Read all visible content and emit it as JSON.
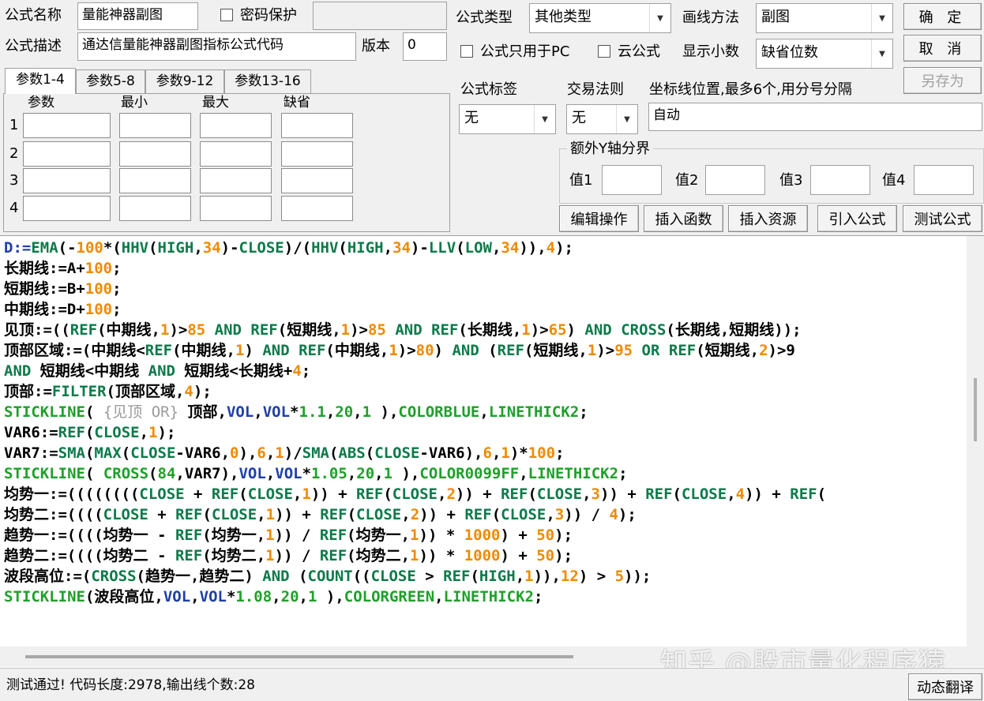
{
  "header": {
    "name_label": "公式名称",
    "name_value": "量能神器副图",
    "password_label": "密码保护",
    "desc_label": "公式描述",
    "desc_value": "通达信量能神器副图指标公式代码",
    "version_label": "版本",
    "version_value": "0",
    "type_label": "公式类型",
    "type_value": "其他类型",
    "draw_label": "画线方法",
    "draw_value": "副图",
    "pc_only_label": "公式只用于PC",
    "cloud_label": "云公式",
    "decimals_label": "显示小数",
    "decimals_value": "缺省位数",
    "ok_button": "确  定",
    "cancel_button": "取  消",
    "save_as_button": "另存为"
  },
  "params": {
    "tabs": [
      "参数1-4",
      "参数5-8",
      "参数9-12",
      "参数13-16"
    ],
    "columns": [
      "参数",
      "最小",
      "最大",
      "缺省"
    ],
    "rows": [
      "1",
      "2",
      "3",
      "4"
    ]
  },
  "options": {
    "tag_label": "公式标签",
    "tag_value": "无",
    "rule_label": "交易法则",
    "rule_value": "无",
    "coord_label": "坐标线位置,最多6个,用分号分隔",
    "coord_value": "自动",
    "yaxis_group": "额外Y轴分界",
    "y_labels": [
      "值1",
      "值2",
      "值3",
      "值4"
    ]
  },
  "actions": [
    "编辑操作",
    "插入函数",
    "插入资源",
    "引入公式",
    "测试公式"
  ],
  "editor": {
    "lines": [
      [
        [
          "D:=",
          "v"
        ],
        [
          "EMA",
          "f"
        ],
        [
          "(-",
          "d"
        ],
        [
          "100",
          "n"
        ],
        [
          "*(",
          "d"
        ],
        [
          "HHV",
          "f"
        ],
        [
          "(",
          "d"
        ],
        [
          "HIGH",
          "f"
        ],
        [
          ",",
          "d"
        ],
        [
          "34",
          "n"
        ],
        [
          ")-",
          "d"
        ],
        [
          "CLOSE",
          "f"
        ],
        [
          ")/(",
          "d"
        ],
        [
          "HHV",
          "f"
        ],
        [
          "(",
          "d"
        ],
        [
          "HIGH",
          "f"
        ],
        [
          ",",
          "d"
        ],
        [
          "34",
          "n"
        ],
        [
          ")-",
          "d"
        ],
        [
          "LLV",
          "f"
        ],
        [
          "(",
          "d"
        ],
        [
          "LOW",
          "f"
        ],
        [
          ",",
          "d"
        ],
        [
          "34",
          "n"
        ],
        [
          ")),",
          "d"
        ],
        [
          "4",
          "n"
        ],
        [
          ");",
          "d"
        ]
      ],
      [
        [
          "长期线:=A+",
          "d"
        ],
        [
          "100",
          "n"
        ],
        [
          ";",
          "d"
        ]
      ],
      [
        [
          "短期线:=B+",
          "d"
        ],
        [
          "100",
          "n"
        ],
        [
          ";",
          "d"
        ]
      ],
      [
        [
          "中期线:=D+",
          "d"
        ],
        [
          "100",
          "n"
        ],
        [
          ";",
          "d"
        ]
      ],
      [
        [
          "见顶:=((",
          "d"
        ],
        [
          "REF",
          "f"
        ],
        [
          "(中期线,",
          "d"
        ],
        [
          "1",
          "n"
        ],
        [
          ")>",
          "d"
        ],
        [
          "85",
          "n"
        ],
        [
          " AND ",
          "f"
        ],
        [
          "REF",
          "f"
        ],
        [
          "(短期线,",
          "d"
        ],
        [
          "1",
          "n"
        ],
        [
          ")>",
          "d"
        ],
        [
          "85",
          "n"
        ],
        [
          " AND ",
          "f"
        ],
        [
          "REF",
          "f"
        ],
        [
          "(长期线,",
          "d"
        ],
        [
          "1",
          "n"
        ],
        [
          ")>",
          "d"
        ],
        [
          "65",
          "n"
        ],
        [
          ") ",
          "d"
        ],
        [
          "AND ",
          "f"
        ],
        [
          "CROSS",
          "f"
        ],
        [
          "(长期线,短期线));",
          "d"
        ]
      ],
      [
        [
          "顶部区域:=(中期线<",
          "d"
        ],
        [
          "REF",
          "f"
        ],
        [
          "(中期线,",
          "d"
        ],
        [
          "1",
          "n"
        ],
        [
          ") ",
          "d"
        ],
        [
          "AND ",
          "f"
        ],
        [
          "REF",
          "f"
        ],
        [
          "(中期线,",
          "d"
        ],
        [
          "1",
          "n"
        ],
        [
          ")>",
          "d"
        ],
        [
          "80",
          "n"
        ],
        [
          ") ",
          "d"
        ],
        [
          "AND ",
          "f"
        ],
        [
          "(",
          "d"
        ],
        [
          "REF",
          "f"
        ],
        [
          "(短期线,",
          "d"
        ],
        [
          "1",
          "n"
        ],
        [
          ")>",
          "d"
        ],
        [
          "95",
          "n"
        ],
        [
          " OR ",
          "f"
        ],
        [
          "REF",
          "f"
        ],
        [
          "(短期线,",
          "d"
        ],
        [
          "2",
          "n"
        ],
        [
          ")>9",
          "d"
        ]
      ],
      [
        [
          "AND ",
          "f"
        ],
        [
          "短期线<中期线 ",
          "d"
        ],
        [
          "AND ",
          "f"
        ],
        [
          "短期线<长期线+",
          "d"
        ],
        [
          "4",
          "n"
        ],
        [
          ";",
          "d"
        ]
      ],
      [
        [
          "顶部:=",
          "d"
        ],
        [
          "FILTER",
          "f"
        ],
        [
          "(顶部区域,",
          "d"
        ],
        [
          "4",
          "n"
        ],
        [
          ");",
          "d"
        ]
      ],
      [
        [
          "STICKLINE",
          "g"
        ],
        [
          "( ",
          "d"
        ],
        [
          "{见顶 OR}",
          "c"
        ],
        [
          " 顶部,",
          "d"
        ],
        [
          "VOL",
          "v"
        ],
        [
          ",",
          "d"
        ],
        [
          "VOL",
          "v"
        ],
        [
          "*",
          "d"
        ],
        [
          "1.1",
          "g"
        ],
        [
          ",",
          "d"
        ],
        [
          "20",
          "g"
        ],
        [
          ",",
          "d"
        ],
        [
          "1",
          "g"
        ],
        [
          " ),",
          "d"
        ],
        [
          "COLORBLUE",
          "g"
        ],
        [
          ",",
          "d"
        ],
        [
          "LINETHICK2",
          "g"
        ],
        [
          ";",
          "d"
        ]
      ],
      [
        [
          "VAR6:=",
          "d"
        ],
        [
          "REF",
          "f"
        ],
        [
          "(",
          "d"
        ],
        [
          "CLOSE",
          "f"
        ],
        [
          ",",
          "d"
        ],
        [
          "1",
          "n"
        ],
        [
          ");",
          "d"
        ]
      ],
      [
        [
          "VAR7:=",
          "d"
        ],
        [
          "SMA",
          "f"
        ],
        [
          "(",
          "d"
        ],
        [
          "MAX",
          "f"
        ],
        [
          "(",
          "d"
        ],
        [
          "CLOSE",
          "f"
        ],
        [
          "-VAR6,",
          "d"
        ],
        [
          "0",
          "n"
        ],
        [
          "),",
          "d"
        ],
        [
          "6",
          "n"
        ],
        [
          ",",
          "d"
        ],
        [
          "1",
          "n"
        ],
        [
          ")/",
          "d"
        ],
        [
          "SMA",
          "f"
        ],
        [
          "(",
          "d"
        ],
        [
          "ABS",
          "f"
        ],
        [
          "(",
          "d"
        ],
        [
          "CLOSE",
          "f"
        ],
        [
          "-VAR6),",
          "d"
        ],
        [
          "6",
          "n"
        ],
        [
          ",",
          "d"
        ],
        [
          "1",
          "n"
        ],
        [
          ")*",
          "d"
        ],
        [
          "100",
          "n"
        ],
        [
          ";",
          "d"
        ]
      ],
      [
        [
          "STICKLINE",
          "g"
        ],
        [
          "( ",
          "d"
        ],
        [
          "CROSS",
          "g"
        ],
        [
          "(",
          "d"
        ],
        [
          "84",
          "g"
        ],
        [
          ",VAR7),",
          "d"
        ],
        [
          "VOL",
          "v"
        ],
        [
          ",",
          "d"
        ],
        [
          "VOL",
          "v"
        ],
        [
          "*",
          "d"
        ],
        [
          "1.05",
          "g"
        ],
        [
          ",",
          "d"
        ],
        [
          "20",
          "g"
        ],
        [
          ",",
          "d"
        ],
        [
          "1",
          "g"
        ],
        [
          " ),",
          "d"
        ],
        [
          "COLOR0099FF",
          "g"
        ],
        [
          ",",
          "d"
        ],
        [
          "LINETHICK2",
          "g"
        ],
        [
          ";",
          "d"
        ]
      ],
      [
        [
          "均势一:=((((((((",
          "d"
        ],
        [
          "CLOSE",
          "f"
        ],
        [
          " + ",
          "d"
        ],
        [
          "REF",
          "f"
        ],
        [
          "(",
          "d"
        ],
        [
          "CLOSE",
          "f"
        ],
        [
          ",",
          "d"
        ],
        [
          "1",
          "n"
        ],
        [
          ")) + ",
          "d"
        ],
        [
          "REF",
          "f"
        ],
        [
          "(",
          "d"
        ],
        [
          "CLOSE",
          "f"
        ],
        [
          ",",
          "d"
        ],
        [
          "2",
          "n"
        ],
        [
          ")) + ",
          "d"
        ],
        [
          "REF",
          "f"
        ],
        [
          "(",
          "d"
        ],
        [
          "CLOSE",
          "f"
        ],
        [
          ",",
          "d"
        ],
        [
          "3",
          "n"
        ],
        [
          ")) + ",
          "d"
        ],
        [
          "REF",
          "f"
        ],
        [
          "(",
          "d"
        ],
        [
          "CLOSE",
          "f"
        ],
        [
          ",",
          "d"
        ],
        [
          "4",
          "n"
        ],
        [
          ")) + ",
          "d"
        ],
        [
          "REF",
          "f"
        ],
        [
          "(",
          "d"
        ]
      ],
      [
        [
          "均势二:=((((",
          "d"
        ],
        [
          "CLOSE",
          "f"
        ],
        [
          " + ",
          "d"
        ],
        [
          "REF",
          "f"
        ],
        [
          "(",
          "d"
        ],
        [
          "CLOSE",
          "f"
        ],
        [
          ",",
          "d"
        ],
        [
          "1",
          "n"
        ],
        [
          ")) + ",
          "d"
        ],
        [
          "REF",
          "f"
        ],
        [
          "(",
          "d"
        ],
        [
          "CLOSE",
          "f"
        ],
        [
          ",",
          "d"
        ],
        [
          "2",
          "n"
        ],
        [
          ")) + ",
          "d"
        ],
        [
          "REF",
          "f"
        ],
        [
          "(",
          "d"
        ],
        [
          "CLOSE",
          "f"
        ],
        [
          ",",
          "d"
        ],
        [
          "3",
          "n"
        ],
        [
          ")) / ",
          "d"
        ],
        [
          "4",
          "n"
        ],
        [
          ");",
          "d"
        ]
      ],
      [
        [
          "趋势一:=((((均势一 - ",
          "d"
        ],
        [
          "REF",
          "f"
        ],
        [
          "(均势一,",
          "d"
        ],
        [
          "1",
          "n"
        ],
        [
          ")) / ",
          "d"
        ],
        [
          "REF",
          "f"
        ],
        [
          "(均势一,",
          "d"
        ],
        [
          "1",
          "n"
        ],
        [
          ")) * ",
          "d"
        ],
        [
          "1000",
          "n"
        ],
        [
          ") + ",
          "d"
        ],
        [
          "50",
          "n"
        ],
        [
          ");",
          "d"
        ]
      ],
      [
        [
          "趋势二:=((((均势二 - ",
          "d"
        ],
        [
          "REF",
          "f"
        ],
        [
          "(均势二,",
          "d"
        ],
        [
          "1",
          "n"
        ],
        [
          ")) / ",
          "d"
        ],
        [
          "REF",
          "f"
        ],
        [
          "(均势二,",
          "d"
        ],
        [
          "1",
          "n"
        ],
        [
          ")) * ",
          "d"
        ],
        [
          "1000",
          "n"
        ],
        [
          ") + ",
          "d"
        ],
        [
          "50",
          "n"
        ],
        [
          ");",
          "d"
        ]
      ],
      [
        [
          "波段高位:=(",
          "d"
        ],
        [
          "CROSS",
          "f"
        ],
        [
          "(趋势一,趋势二) ",
          "d"
        ],
        [
          "AND ",
          "f"
        ],
        [
          "(",
          "d"
        ],
        [
          "COUNT",
          "f"
        ],
        [
          "((",
          "d"
        ],
        [
          "CLOSE",
          "f"
        ],
        [
          " > ",
          "d"
        ],
        [
          "REF",
          "f"
        ],
        [
          "(",
          "d"
        ],
        [
          "HIGH",
          "f"
        ],
        [
          ",",
          "d"
        ],
        [
          "1",
          "n"
        ],
        [
          ")),",
          "d"
        ],
        [
          "12",
          "n"
        ],
        [
          ") > ",
          "d"
        ],
        [
          "5",
          "n"
        ],
        [
          "));",
          "d"
        ]
      ],
      [
        [
          "STICKLINE",
          "g"
        ],
        [
          "(波段高位,",
          "d"
        ],
        [
          "VOL",
          "v"
        ],
        [
          ",",
          "d"
        ],
        [
          "VOL",
          "v"
        ],
        [
          "*",
          "d"
        ],
        [
          "1.08",
          "g"
        ],
        [
          ",",
          "d"
        ],
        [
          "20",
          "g"
        ],
        [
          ",",
          "d"
        ],
        [
          "1",
          "g"
        ],
        [
          " ),",
          "d"
        ],
        [
          "COLORGREEN",
          "g"
        ],
        [
          ",",
          "d"
        ],
        [
          "LINETHICK2",
          "g"
        ],
        [
          ";",
          "d"
        ]
      ]
    ]
  },
  "colors": {
    "d": "#000000",
    "f": "#0d7a4a",
    "n": "#f08a00",
    "v": "#1f3fa8",
    "g": "#1fa02a",
    "c": "#9a9a9a"
  },
  "status": {
    "text": "测试通过! 代码长度:2978,输出线个数:28",
    "translate_button": "动态翻译"
  },
  "watermark": "知乎 @股市量化程序猿"
}
